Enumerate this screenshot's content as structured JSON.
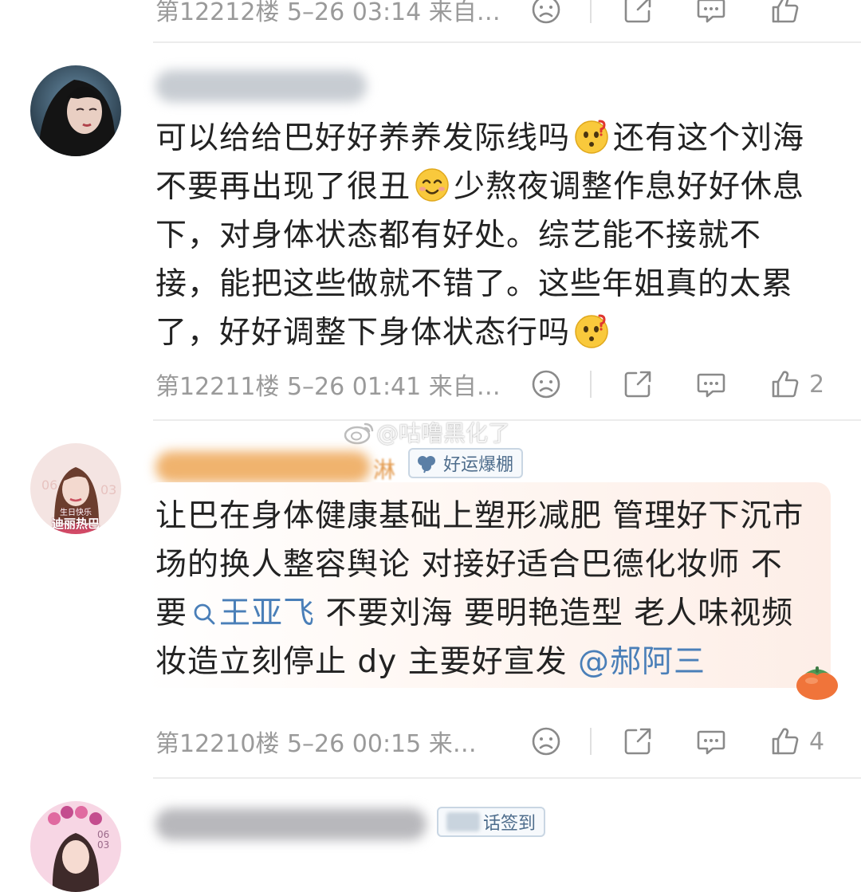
{
  "colors": {
    "meta_text": "#9a9a9a",
    "body_text": "#222222",
    "link": "#4a7fb8",
    "highlight_bg": "#fdeee7",
    "badge_border": "#c9d6e3"
  },
  "comments": [
    {
      "meta": "第12212楼 5–26 03:14 来自…",
      "likes": ""
    },
    {
      "username": "",
      "text_lines": [
        "可以给给巴好好养养发际线吗",
        "还有这个刘海",
        "不要再出现了很丑",
        "少熬夜调整作息好好休息",
        "下，对身体状态都有好处。综艺能不接就不",
        "接，能把这些做就不错了。这些年姐真的太累",
        "了，好好调整下身体状态行吗"
      ],
      "emojis": [
        "confused-face-emoji",
        "smiling-face-emoji",
        "confused-face-emoji"
      ],
      "meta": "第12211楼 5–26 01:41 来自…",
      "likes": "2"
    },
    {
      "username": "",
      "username_tail": "淋",
      "badge": "好运爆棚",
      "avatar_caption_line1": "生日快乐",
      "avatar_caption_line2": "迪丽热巴",
      "text_lines": [
        "让巴在身体健康基础上塑形减肥 管理好下沉市",
        "场的换人整容舆论 对接好适合巴德化妆师 不",
        "要",
        "王亚飞",
        " 不要刘海 要明艳造型 老人味视频",
        "妆造立刻停止 dy 主要好宣发 ",
        "@郝阿三"
      ],
      "meta": "第12210楼 5–26 00:15 来…",
      "likes": "4"
    },
    {
      "username": "",
      "badge": "话签到",
      "avatar_caption": "06 03"
    }
  ],
  "watermark": "@咕噜黑化了"
}
